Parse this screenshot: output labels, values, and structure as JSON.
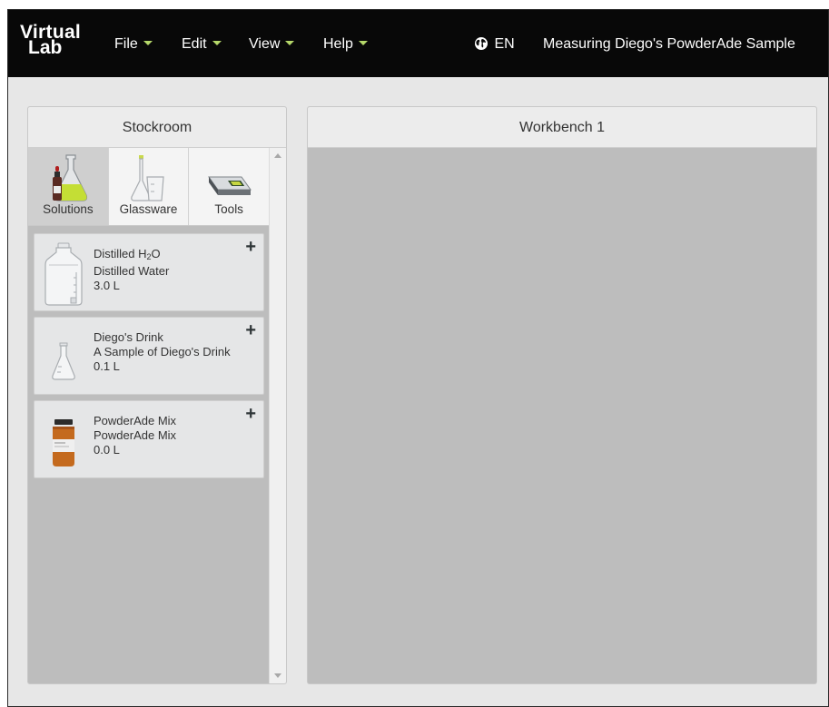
{
  "app": {
    "logo_line1": "Virtual",
    "logo_line2": "Lab",
    "title": "Measuring Diego's PowderAde Sample"
  },
  "menu": [
    {
      "label": "File"
    },
    {
      "label": "Edit"
    },
    {
      "label": "View"
    },
    {
      "label": "Help"
    }
  ],
  "language": {
    "label": "EN",
    "icon": "globe-icon"
  },
  "stockroom": {
    "title": "Stockroom",
    "tabs": [
      {
        "label": "Solutions",
        "icon": "solutions-icon",
        "active": true
      },
      {
        "label": "Glassware",
        "icon": "glassware-icon",
        "active": false
      },
      {
        "label": "Tools",
        "icon": "scale-icon",
        "active": false
      }
    ],
    "items": [
      {
        "name_prefix": "Distilled H",
        "name_sub": "2",
        "name_suffix": "O",
        "description": "Distilled Water",
        "volume": "3.0 L",
        "icon": "water-jug-icon"
      },
      {
        "name": "Diego's Drink",
        "description": "A Sample of Diego's Drink",
        "volume": "0.1 L",
        "icon": "flask-icon"
      },
      {
        "name": "PowderAde Mix",
        "description": "PowderAde Mix",
        "volume": "0.0 L",
        "icon": "jar-icon"
      }
    ],
    "add_label": "+"
  },
  "workbench": {
    "title": "Workbench 1"
  },
  "colors": {
    "navbar": "#080808",
    "caret": "#b5d86a",
    "panel_bg": "#bdbdbd",
    "frame_bg": "#e7e7e7"
  }
}
